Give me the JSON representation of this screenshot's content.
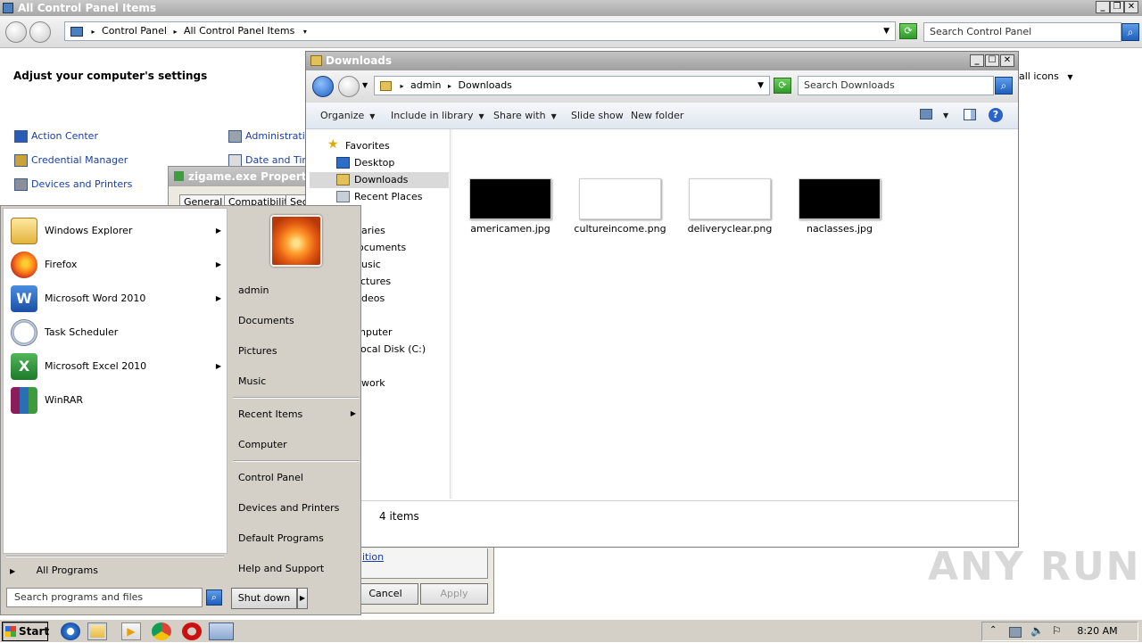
{
  "control_panel": {
    "title": "All Control Panel Items",
    "breadcrumb": [
      "Control Panel",
      "All Control Panel Items"
    ],
    "search_placeholder": "Search Control Panel",
    "heading": "Adjust your computer's settings",
    "view_by": "all icons",
    "items_left": [
      "Action Center",
      "Credential Manager",
      "Devices and Printers"
    ],
    "items_right": [
      "Administrative",
      "Date and Time"
    ]
  },
  "properties_dialog": {
    "title": "zigame.exe Properties",
    "tabs": [
      "General",
      "Compatibility",
      "Sec"
    ],
    "link_text": "ition",
    "cancel": "Cancel",
    "apply": "Apply"
  },
  "downloads": {
    "title": "Downloads",
    "breadcrumb": [
      "admin",
      "Downloads"
    ],
    "search_placeholder": "Search Downloads",
    "toolbar": {
      "organize": "Organize",
      "include": "Include in library",
      "share": "Share with",
      "slideshow": "Slide show",
      "new_folder": "New folder"
    },
    "nav": {
      "favorites": "Favorites",
      "desktop": "Desktop",
      "downloads": "Downloads",
      "recent": "Recent Places",
      "libraries": "aries",
      "documents": "ocuments",
      "music": "usic",
      "pictures": "ctures",
      "videos": "deos",
      "computer": "nputer",
      "local_disk": "ocal Disk (C:)",
      "network": "work"
    },
    "files": [
      {
        "name": "americamen.jpg",
        "thumb_color": "#000000"
      },
      {
        "name": "cultureincome.png",
        "thumb_color": "#ffffff"
      },
      {
        "name": "deliveryclear.png",
        "thumb_color": "#ffffff"
      },
      {
        "name": "naclasses.jpg",
        "thumb_color": "#000000"
      }
    ],
    "status": "4 items"
  },
  "start_menu": {
    "programs": [
      {
        "label": "Windows Explorer",
        "icon": "folder-icon",
        "has_submenu": true
      },
      {
        "label": "Firefox",
        "icon": "firefox-icon",
        "has_submenu": true
      },
      {
        "label": "Microsoft Word 2010",
        "icon": "word-icon",
        "has_submenu": true
      },
      {
        "label": "Task Scheduler",
        "icon": "clock-icon",
        "has_submenu": false
      },
      {
        "label": "Microsoft Excel 2010",
        "icon": "excel-icon",
        "has_submenu": true
      },
      {
        "label": "WinRAR",
        "icon": "winrar-icon",
        "has_submenu": false
      }
    ],
    "all_programs": "All Programs",
    "search_placeholder": "Search programs and files",
    "right": {
      "user": "admin",
      "documents": "Documents",
      "pictures": "Pictures",
      "music": "Music",
      "recent_items": "Recent Items",
      "computer": "Computer",
      "control_panel": "Control Panel",
      "devices": "Devices and Printers",
      "default_programs": "Default Programs",
      "help": "Help and Support"
    },
    "shutdown": "Shut down"
  },
  "taskbar": {
    "start": "Start",
    "clock": "8:20 AM"
  },
  "watermark": "ANY RUN"
}
